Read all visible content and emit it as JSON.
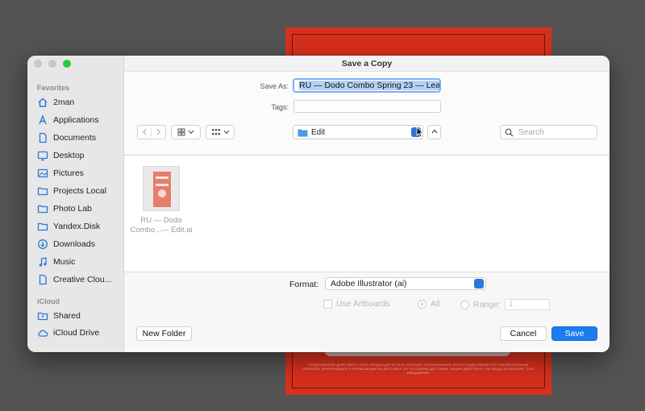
{
  "artboard": {
    "fine_print": "ПРЕДЛОЖЕНИЕ ДЕЙСТВУЕТ, ПОКА ПРОДУКЦИЯ ЕСТЬ В НАЛИЧИИ. ИЗОБРАЖЕНИЕ ФОТОСТЕНДА ЯВЛЯЕТСЯ СОБИРАТЕЛЬНЫМ ОБРАЗОМ. ИНФОРМАЦИЯ О ПРОМОАКЦИИ НА ДОСТАВКУ ПО УСЛОВИЯМ ДОСТАВКИ. АКЦИЯ ДЕЙСТВУЕТ НА ПИЦЦУ ИЗ НАБОРА. ООО «ПИЦЦЕРИЯ»."
  },
  "window": {
    "title": "Save a Copy"
  },
  "sidebar": {
    "favorites_heading": "Favorites",
    "favorites": [
      {
        "label": "2man",
        "icon": "home-icon"
      },
      {
        "label": "Applications",
        "icon": "applications-icon"
      },
      {
        "label": "Documents",
        "icon": "document-icon"
      },
      {
        "label": "Desktop",
        "icon": "desktop-icon"
      },
      {
        "label": "Pictures",
        "icon": "pictures-icon"
      },
      {
        "label": "Projects Local",
        "icon": "folder-icon"
      },
      {
        "label": "Photo Lab",
        "icon": "folder-icon"
      },
      {
        "label": "Yandex.Disk",
        "icon": "folder-icon"
      },
      {
        "label": "Downloads",
        "icon": "downloads-icon"
      },
      {
        "label": "Music",
        "icon": "music-icon"
      },
      {
        "label": "Creative Clou...",
        "icon": "document-icon"
      }
    ],
    "icloud_heading": "iCloud",
    "icloud": [
      {
        "label": "Shared",
        "icon": "shared-folder-icon"
      },
      {
        "label": "iCloud Drive",
        "icon": "cloud-icon"
      }
    ]
  },
  "form": {
    "save_as_label": "Save As:",
    "save_as_value": "RU — Dodo Combo Spring 23 — Lea",
    "tags_label": "Tags:",
    "tags_value": ""
  },
  "toolbar": {
    "location": "Edit",
    "search_placeholder": "Search"
  },
  "files": [
    {
      "name_line1": "RU — Dodo",
      "name_line2": "Combo...— Edit.ai"
    }
  ],
  "options": {
    "format_label": "Format:",
    "format_value": "Adobe Illustrator (ai)",
    "use_artboards_label": "Use Artboards",
    "all_label": "All",
    "range_label": "Range:",
    "range_value": "1"
  },
  "buttons": {
    "new_folder": "New Folder",
    "cancel": "Cancel",
    "save": "Save"
  },
  "colors": {
    "accent": "#1a7cf0",
    "artboard": "#d7301d"
  }
}
